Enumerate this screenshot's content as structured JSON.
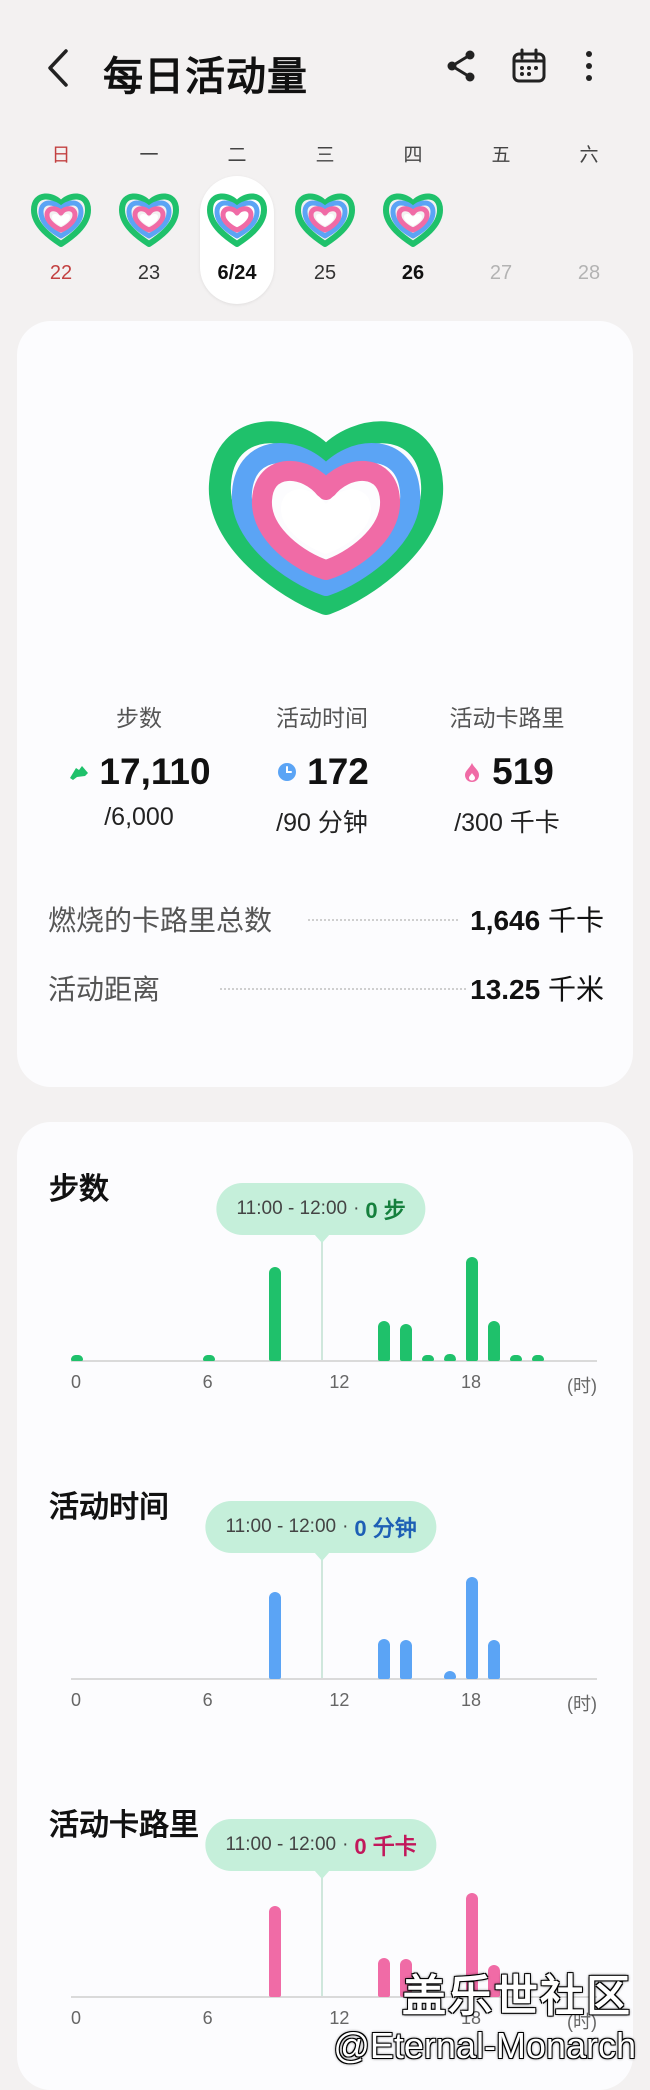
{
  "header": {
    "title": "每日活动量",
    "icons": [
      "back-arrow-icon",
      "share-icon",
      "calendar-icon",
      "more-vert-icon"
    ]
  },
  "week": {
    "weekdays": [
      "日",
      "一",
      "二",
      "三",
      "四",
      "五",
      "六"
    ],
    "days": [
      {
        "label": "22",
        "has_ring": true
      },
      {
        "label": "23",
        "has_ring": true
      },
      {
        "label": "6/24",
        "has_ring": true,
        "selected": true
      },
      {
        "label": "25",
        "has_ring": true
      },
      {
        "label": "26",
        "has_ring": true
      },
      {
        "label": "27",
        "has_ring": false
      },
      {
        "label": "28",
        "has_ring": false
      }
    ]
  },
  "summary": {
    "metrics": [
      {
        "label": "步数",
        "value": "17,110",
        "goal": "/6,000",
        "icon": "shoe-icon",
        "color": "#1fc16b"
      },
      {
        "label": "活动时间",
        "value": "172",
        "goal": "/90 分钟",
        "icon": "clock-icon",
        "color": "#5ba4f5"
      },
      {
        "label": "活动卡路里",
        "value": "519",
        "goal": "/300 千卡",
        "icon": "flame-icon",
        "color": "#f06ba6"
      }
    ],
    "rows": [
      {
        "label": "燃烧的卡路里总数",
        "value": "1,646",
        "unit": "千卡"
      },
      {
        "label": "活动距离",
        "value": "13.25",
        "unit": "千米"
      }
    ]
  },
  "charts": [
    {
      "title": "步数",
      "tooltip_time": "11:00 - 12:00",
      "tooltip_sep": "·",
      "tooltip_value": "0 步",
      "tooltip_color": "#15803d",
      "bar_color": "#1fc16b",
      "x_ticks": [
        "0",
        "6",
        "12",
        "18"
      ],
      "x_unit": "(时)"
    },
    {
      "title": "活动时间",
      "tooltip_time": "11:00 - 12:00",
      "tooltip_sep": "·",
      "tooltip_value": "0 分钟",
      "tooltip_color": "#1d5fb5",
      "bar_color": "#5ba4f5",
      "x_ticks": [
        "0",
        "6",
        "12",
        "18"
      ],
      "x_unit": "(时)"
    },
    {
      "title": "活动卡路里",
      "tooltip_time": "11:00 - 12:00",
      "tooltip_sep": "·",
      "tooltip_value": "0 千卡",
      "tooltip_color": "#c2185b",
      "bar_color": "#f06ba6",
      "x_ticks": [
        "0",
        "6",
        "12",
        "18"
      ],
      "x_unit": "(时)"
    }
  ],
  "chart_data": [
    {
      "type": "bar",
      "title": "步数",
      "x": [
        0,
        1,
        2,
        3,
        4,
        5,
        6,
        7,
        8,
        9,
        10,
        11,
        12,
        13,
        14,
        15,
        16,
        17,
        18,
        19,
        20,
        21,
        22,
        23
      ],
      "values": [
        40,
        0,
        0,
        0,
        0,
        0,
        40,
        0,
        0,
        900,
        0,
        0,
        0,
        0,
        380,
        360,
        50,
        70,
        1000,
        380,
        50,
        50,
        0,
        0
      ],
      "xlabel": "(时)",
      "xticks": [
        "0",
        "6",
        "12",
        "18"
      ]
    },
    {
      "type": "bar",
      "title": "活动时间",
      "x": [
        0,
        1,
        2,
        3,
        4,
        5,
        6,
        7,
        8,
        9,
        10,
        11,
        12,
        13,
        14,
        15,
        16,
        17,
        18,
        19,
        20,
        21,
        22,
        23
      ],
      "values": [
        0,
        0,
        0,
        0,
        0,
        0,
        0,
        0,
        0,
        54,
        0,
        0,
        0,
        0,
        25,
        24,
        0,
        5,
        63,
        24,
        0,
        0,
        0,
        0
      ],
      "xlabel": "(时)",
      "xticks": [
        "0",
        "6",
        "12",
        "18"
      ]
    },
    {
      "type": "bar",
      "title": "活动卡路里",
      "x": [
        0,
        1,
        2,
        3,
        4,
        5,
        6,
        7,
        8,
        9,
        10,
        11,
        12,
        13,
        14,
        15,
        16,
        17,
        18,
        19,
        20,
        21,
        22,
        23
      ],
      "values": [
        0,
        0,
        0,
        0,
        0,
        0,
        0,
        0,
        0,
        140,
        0,
        0,
        0,
        0,
        60,
        58,
        0,
        0,
        160,
        50,
        0,
        0,
        0,
        0
      ],
      "xlabel": "(时)",
      "xticks": [
        "0",
        "6",
        "12",
        "18"
      ]
    }
  ],
  "watermark": {
    "line1": "盖乐世社区",
    "line2": "@Eternal-Monarch"
  }
}
